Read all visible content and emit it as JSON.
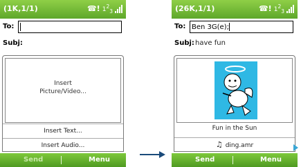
{
  "left": {
    "title": "(1K,1/1)",
    "status": {
      "signal_badge": "!",
      "network": "1",
      "network_sub": "2",
      "network_num": "3"
    },
    "to_label": "To:",
    "to_value": "",
    "subj_label": "Subj:",
    "subj_value": "",
    "insert_picture": "Insert\nPicture/Video...",
    "insert_text": "Insert Text...",
    "insert_audio": "Insert Audio...",
    "softkeys": {
      "left": "Send",
      "right": "Menu"
    }
  },
  "right": {
    "title": "(26K,1/1)",
    "status": {
      "signal_badge": "!",
      "network": "1",
      "network_sub": "2",
      "network_num": "3"
    },
    "to_label": "To:",
    "to_value": "Ben 3G(e);",
    "subj_label": "Subj:",
    "subj_value": "have fun",
    "caption": "Fun in the Sun",
    "audio_file": "ding.amr",
    "softkeys": {
      "left": "Send",
      "right": "Menu"
    }
  },
  "icons": {
    "left_status": [
      "phone-alert-icon",
      "network-icon",
      "signal-icon"
    ],
    "right_status": [
      "phone-alert-icon",
      "network-icon",
      "signal-icon"
    ],
    "audio": "music-note-icon",
    "arrow": "flow-arrow-icon"
  },
  "colors": {
    "titlebar": "#6fbe36",
    "softbar": "#5ea72a",
    "cherub_bg": "#2fb8e4",
    "arrow": "#1a4a7a"
  }
}
